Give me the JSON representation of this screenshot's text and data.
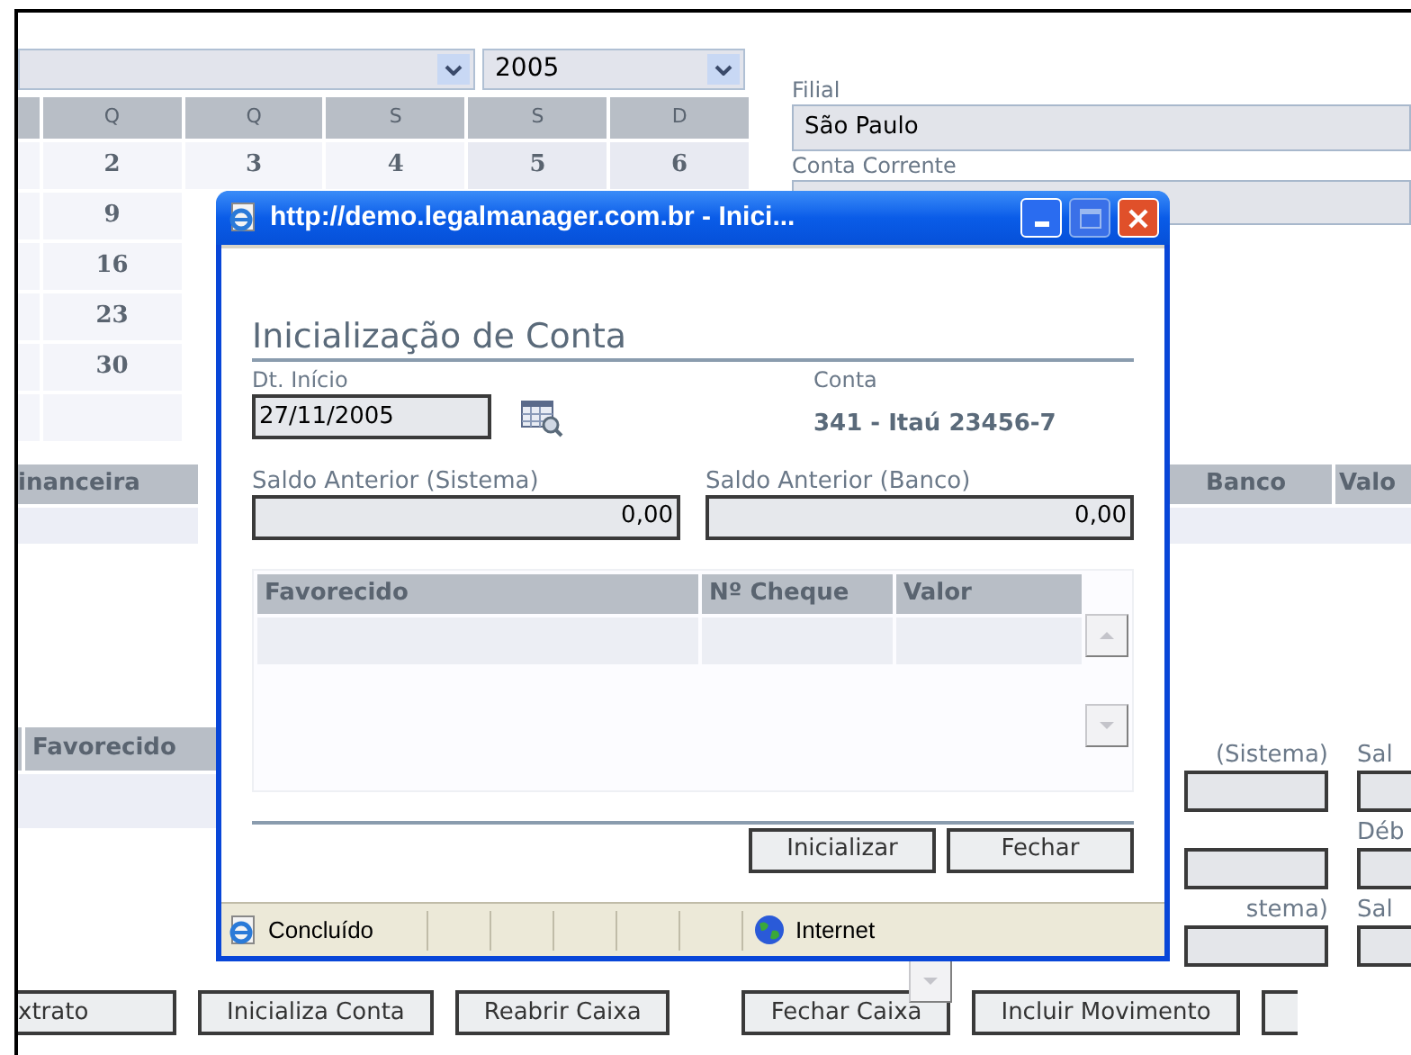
{
  "calendar": {
    "year_select": {
      "value": "2005"
    },
    "weekdays": [
      "Q",
      "Q",
      "S",
      "S",
      "D"
    ],
    "weeks": [
      [
        "2",
        "3",
        "4",
        "5",
        "6"
      ],
      [
        "9"
      ],
      [
        "16"
      ],
      [
        "23"
      ],
      [
        "30"
      ]
    ]
  },
  "branch": {
    "label": "Filial",
    "value": "São Paulo"
  },
  "account_field": {
    "label": "Conta Corrente"
  },
  "movements_table": {
    "columns": [
      "inanceira",
      "Banco",
      "Valo"
    ]
  },
  "second_table": {
    "columns": [
      "Favorecido"
    ]
  },
  "balance_fields": [
    {
      "left": "(Sistema)",
      "right": "Sal"
    },
    {
      "right": "Déb"
    },
    {
      "left": "stema)",
      "right": "Sal"
    }
  ],
  "buttons": [
    "xtrato",
    "Inicializa Conta",
    "Reabrir Caixa",
    "Fechar Caixa",
    "Incluir Movimento"
  ],
  "popup": {
    "title": "http://demo.legalmanager.com.br - Inici...",
    "heading": "Inicialização de Conta",
    "start_date": {
      "label": "Dt. Início",
      "value": "27/11/2005"
    },
    "account": {
      "label": "Conta",
      "value": "341 - Itaú 23456-7"
    },
    "balances": [
      {
        "label": "Saldo Anterior (Sistema)",
        "value": "0,00"
      },
      {
        "label": "Saldo Anterior (Banco)",
        "value": "0,00"
      }
    ],
    "table": {
      "columns": [
        "Favorecido",
        "Nº Cheque",
        "Valor"
      ]
    },
    "buttons": [
      "Inicializar",
      "Fechar"
    ],
    "status_bar": {
      "text": "Concluído",
      "zone": "Internet"
    }
  }
}
